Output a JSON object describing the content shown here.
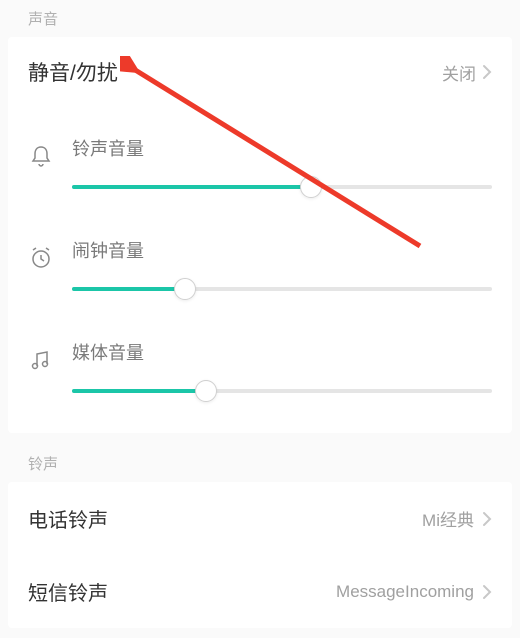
{
  "sections": {
    "sound": {
      "header": "声音",
      "silent_dnd": {
        "title": "静音/勿扰",
        "value": "关闭"
      },
      "sliders": {
        "ringtone": {
          "label": "铃声音量",
          "percent": 57
        },
        "alarm": {
          "label": "闹钟音量",
          "percent": 27
        },
        "media": {
          "label": "媒体音量",
          "percent": 32
        }
      }
    },
    "ringtone": {
      "header": "铃声",
      "phone": {
        "title": "电话铃声",
        "value": "Mi经典"
      },
      "sms": {
        "title": "短信铃声",
        "value": "MessageIncoming"
      }
    }
  },
  "colors": {
    "accent": "#1bc6a8",
    "annotation": "#ed3a2a"
  }
}
